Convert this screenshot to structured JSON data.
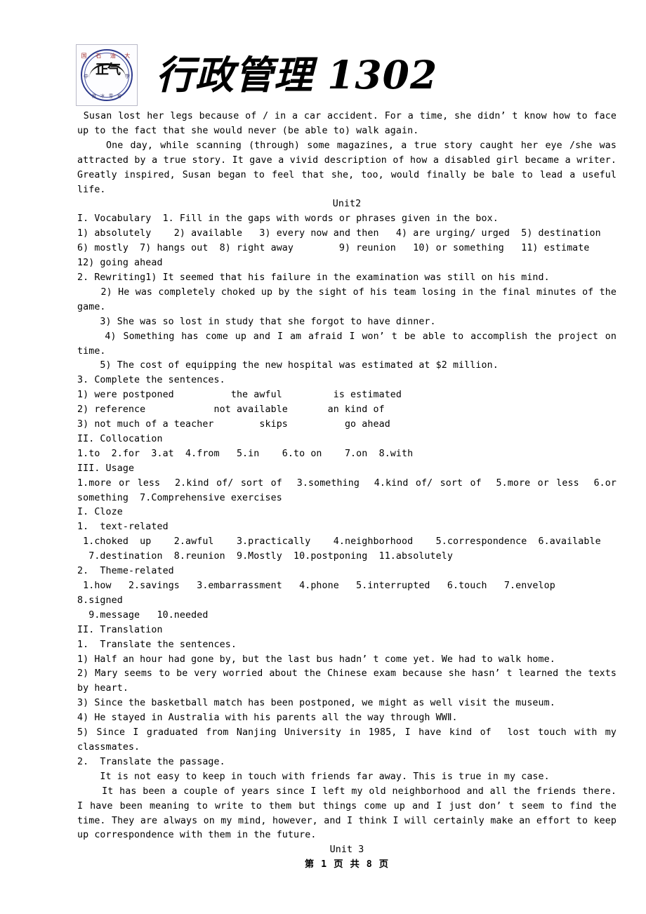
{
  "header": {
    "title": "行政管理 1302",
    "seal": {
      "top_text": "国 石 油 大",
      "left_text": "中",
      "right_text": "学",
      "center_text": "正气",
      "bottom_text": "胜 冰 雪 窗"
    }
  },
  "body": {
    "para_susan": [
      " Susan lost her legs because of / in a car accident. For a time, she didn’ t know how to face up to the fact that she would never (be able to) walk again.",
      "    One day, while scanning (through) some magazines, a true story caught her eye /she was attracted by a true story. It gave a vivid description of how a disabled girl became a writer. Greatly inspired, Susan began to feel that she, too, would finally be bale to lead a useful life."
    ],
    "unit_heading": "Unit2",
    "vocabulary": {
      "heading": "I. Vocabulary  1. Fill in the gaps with words or phrases given in the box.",
      "answers_line1": "1) absolutely    2) available   3) every now and then   4) are urging/ urged  5) destination",
      "answers_line2": "6) mostly  7) hangs out  8) right away        9) reunion   10) or something   11) estimate",
      "answers_line3": "12) going ahead"
    },
    "rewriting": {
      "item1": "2. Rewriting1) It seemed that his failure in the examination was still on his mind.",
      "item2": "    2) He was completely choked up by the sight of his team losing in the final minutes of the game.",
      "item3": "    3) She was so lost in study that she forgot to have dinner.",
      "item4": "    4) Something has come up and I am afraid I won’ t be able to accomplish the project on time.",
      "item5": "    5) The cost of equipping the new hospital was estimated at $2 million."
    },
    "complete_sentences": {
      "heading": "3. Complete the sentences.",
      "row1": "1) were postponed          the awful         is estimated",
      "row2": "2) reference            not available       an kind of",
      "row3": "3) not much of a teacher        skips          go ahead"
    },
    "collocation": {
      "heading": "II. Collocation",
      "answers": "1.to  2.for  3.at  4.from   5.in    6.to on    7.on  8.with"
    },
    "usage": {
      "heading": "III. Usage",
      "answers_line1": "1.more or less  2.kind of/ sort of  3.something  4.kind of/ sort of  5.more or less  6.or something  7.Comprehensive exercises"
    },
    "cloze": {
      "heading": "I. Cloze",
      "sub1": "1.  text-related",
      "sub1_line1": " 1.choked  up    2.awful    3.practically    4.neighborhood    5.correspondence  6.available",
      "sub1_line2": "  7.destination  8.reunion  9.Mostly  10.postponing  11.absolutely",
      "sub2": "2.  Theme-related",
      "sub2_line1": " 1.how   2.savings   3.embarrassment   4.phone   5.interrupted   6.touch   7.envelop   8.signed",
      "sub2_line2": "  9.message   10.needed"
    },
    "translation": {
      "heading": "II. Translation",
      "sub1": "1.  Translate the sentences.",
      "s1": "1) Half an hour had gone by, but the last bus hadn’ t come yet. We had to walk home.",
      "s2": "2) Mary seems to be very worried about the Chinese exam because she hasn’ t learned the texts by heart.",
      "s3": "3) Since the basketball match has been postponed, we might as well visit the museum.",
      "s4": "4) He stayed in Australia with his parents all the way through WWⅡ.",
      "s5": "5) Since I graduated from Nanjing University in 1985, I have kind of  lost touch with my classmates.",
      "sub2": "2.  Translate the passage.",
      "p1": "    It is not easy to keep in touch with friends far away. This is true in my case.",
      "p2": "    It has been a couple of years since I left my old neighborhood and all the friends there. I have been meaning to write to them but things come up and I just don’ t seem to find the time. They are always on my mind, however, and I think I will certainly make an effort to keep up correspondence with them in the future."
    },
    "next_unit": "Unit 3"
  },
  "footer": {
    "page_info": "第 1 页 共 8 页"
  }
}
